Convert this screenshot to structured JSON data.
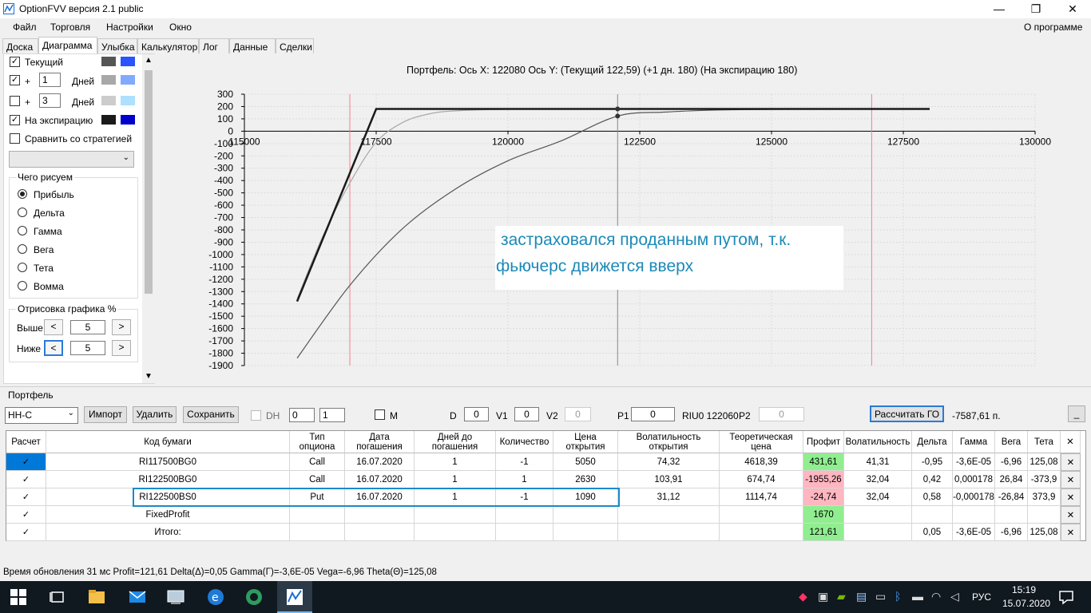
{
  "window": {
    "title": "OptionFVV версия 2.1 public"
  },
  "menu": {
    "items": [
      "Файл",
      "Торговля",
      "Настройки",
      "Окно"
    ],
    "about": "О программе"
  },
  "tabs": [
    "Доска",
    "Диаграмма",
    "Улыбка",
    "Калькулятор",
    "Лог",
    "Данные",
    "Сделки"
  ],
  "left": {
    "current_label": "Текущий",
    "plus1": {
      "sign": "+",
      "value": "1",
      "unit": "Дней"
    },
    "plus2": {
      "sign": "+",
      "value": "3",
      "unit": "Дней"
    },
    "expiry_label": "На экспирацию",
    "compare_label": "Сравнить со стратегией",
    "draw_group": "Чего рисуем",
    "radios": [
      "Прибыль",
      "Дельта",
      "Гамма",
      "Вега",
      "Тета",
      "Вомма"
    ],
    "range_group": "Отрисовка графика %",
    "above_label": "Выше",
    "above_value": "5",
    "below_label": "Ниже",
    "below_value": "5",
    "colors": {
      "current": [
        "#555555",
        "#2a52ff"
      ],
      "plus1": [
        "#a8a8a8",
        "#80aaff"
      ],
      "plus2": [
        "#cccccc",
        "#aee0ff"
      ],
      "expiry": [
        "#1a1a1a",
        "#0000cc"
      ]
    }
  },
  "chart": {
    "header": "Портфель:  Ось X:  122080  Ось Y:   (Текущий 122,59)   (+1 дн. 180)   (На экспирацию 180)",
    "annotation_line1": "застраховался проданным путом, т.к.",
    "annotation_line2": "фьючерс движется вверх",
    "x_ticks": [
      "115000",
      "117500",
      "120000",
      "122500",
      "125000",
      "127500",
      "130000"
    ],
    "y_ticks": [
      "300",
      "200",
      "100",
      "0",
      "-100",
      "-200",
      "-300",
      "-400",
      "-500",
      "-600",
      "-700",
      "-800",
      "-900",
      "-1000",
      "-1100",
      "-1200",
      "-1300",
      "-1400",
      "-1500",
      "-1600",
      "-1700",
      "-1800",
      "-1900"
    ]
  },
  "chart_data": {
    "type": "line",
    "xlim": [
      115000,
      130000
    ],
    "ylim": [
      -1900,
      300
    ],
    "vlines_red": [
      117000,
      126900
    ],
    "vline_current": 122080,
    "series": [
      {
        "name": "Текущий",
        "color": "#555555",
        "x": [
          116000,
          117000,
          118000,
          119000,
          120000,
          121000,
          122080,
          123000,
          124000,
          125000,
          126000,
          127000,
          128000
        ],
        "y": [
          -1840,
          -1250,
          -790,
          -470,
          -240,
          -80,
          122.59,
          155,
          172,
          177,
          179,
          180,
          180
        ]
      },
      {
        "name": "+1 дн.",
        "color": "#a8a8a8",
        "x": [
          116000,
          116500,
          117000,
          117500,
          118000,
          118500,
          119000,
          120000,
          121000,
          122080,
          125000,
          128000
        ],
        "y": [
          -1360,
          -840,
          -420,
          -90,
          70,
          140,
          165,
          178,
          180,
          180,
          180,
          180
        ]
      },
      {
        "name": "На экспирацию",
        "color": "#1a1a1a",
        "x": [
          116000,
          117500,
          128000
        ],
        "y": [
          -1380,
          180,
          180
        ]
      }
    ],
    "points": [
      {
        "x": 122080,
        "y": 180
      },
      {
        "x": 122080,
        "y": 122.59
      }
    ]
  },
  "portfolio": {
    "label": "Портфель",
    "select_value": "НН-С",
    "import_label": "Импорт",
    "delete_label": "Удалить",
    "save_label": "Сохранить",
    "dh_label": "DH",
    "spin1": "0",
    "spin2": "1",
    "m_label": "M",
    "d_label": "D",
    "d_value": "0",
    "v1_label": "V1",
    "v1_value": "0",
    "v2_label": "V2",
    "v2_value": "0",
    "p1_label": "P1",
    "p1_value": "0",
    "riu_label": "RIU0 122060",
    "p2_label": "P2",
    "p2_value": "0",
    "calc_go_label": "Рассчитать ГО",
    "go_value": "-7587,61 п.",
    "min_label": "_"
  },
  "table": {
    "headers": [
      "Расчет",
      "Код бумаги",
      "Тип\nопциона",
      "Дата\nпогашения",
      "Дней до\nпогашения",
      "Количество",
      "Цена\nоткрытия",
      "Волатильность\nоткрытия",
      "Теоретическая\nцена",
      "Профит",
      "Волатильность",
      "Дельта",
      "Гамма",
      "Вега",
      "Тета",
      "✕"
    ],
    "rows": [
      [
        "✓",
        "RI117500BG0",
        "Call",
        "16.07.2020",
        "1",
        "-1",
        "5050",
        "74,32",
        "4618,39",
        "431,61",
        "41,31",
        "-0,95",
        "-3,6E-05",
        "-6,96",
        "125,08",
        "✕"
      ],
      [
        "✓",
        "RI122500BG0",
        "Call",
        "16.07.2020",
        "1",
        "1",
        "2630",
        "103,91",
        "674,74",
        "-1955,26",
        "32,04",
        "0,42",
        "0,000178",
        "26,84",
        "-373,9",
        "✕"
      ],
      [
        "✓",
        "RI122500BS0",
        "Put",
        "16.07.2020",
        "1",
        "-1",
        "1090",
        "31,12",
        "1114,74",
        "-24,74",
        "32,04",
        "0,58",
        "-0,000178",
        "-26,84",
        "373,9",
        "✕"
      ],
      [
        "✓",
        "FixedProfit",
        "",
        "",
        "",
        "",
        "",
        "",
        "",
        "1670",
        "",
        "",
        "",
        "",
        "",
        "✕"
      ],
      [
        "✓",
        "Итого:",
        "",
        "",
        "",
        "",
        "",
        "",
        "",
        "121,61",
        "",
        "0,05",
        "-3,6E-05",
        "-6,96",
        "125,08",
        "✕"
      ]
    ],
    "profit_colors": [
      "#90ee90",
      "#ffb6c1",
      "#ffb6c1",
      "#90ee90",
      "#90ee90"
    ]
  },
  "status": {
    "text": "Время обновления 31 мс   Profit=121,61 Delta(Δ)=0,05 Gamma(Γ)=-3,6E-05 Vega=-6,96 Theta(Θ)=125,08"
  },
  "taskbar": {
    "lang": "РУС",
    "time": "15:19",
    "date": "15.07.2020"
  }
}
